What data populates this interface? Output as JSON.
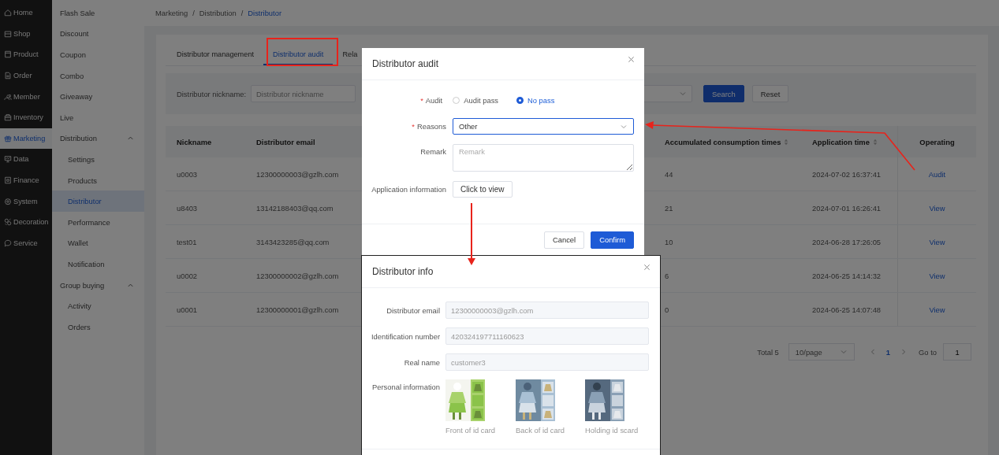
{
  "sidebar": {
    "items": [
      {
        "label": "Home",
        "selected": false
      },
      {
        "label": "Shop",
        "selected": false
      },
      {
        "label": "Product",
        "selected": false
      },
      {
        "label": "Order",
        "selected": false
      },
      {
        "label": "Member",
        "selected": false
      },
      {
        "label": "Inventory",
        "selected": false
      },
      {
        "label": "Marketing",
        "selected": true
      },
      {
        "label": "Data",
        "selected": false
      },
      {
        "label": "Finance",
        "selected": false
      },
      {
        "label": "System",
        "selected": false
      },
      {
        "label": "Decoration",
        "selected": false
      },
      {
        "label": "Service",
        "selected": false
      }
    ]
  },
  "submenu": {
    "items": [
      {
        "label": "Flash Sale",
        "selected": false
      },
      {
        "label": "Discount",
        "selected": false
      },
      {
        "label": "Coupon",
        "selected": false
      },
      {
        "label": "Combo",
        "selected": false
      },
      {
        "label": "Giveaway",
        "selected": false
      },
      {
        "label": "Live",
        "selected": false
      },
      {
        "label": "Distribution",
        "selected": false,
        "expanded": true,
        "children": [
          {
            "label": "Settings",
            "selected": false
          },
          {
            "label": "Products",
            "selected": false
          },
          {
            "label": "Distributor",
            "selected": true
          },
          {
            "label": "Performance",
            "selected": false
          },
          {
            "label": "Wallet",
            "selected": false
          },
          {
            "label": "Notification",
            "selected": false
          }
        ]
      },
      {
        "label": "Group buying",
        "selected": false,
        "expanded": true,
        "children": [
          {
            "label": "Activity",
            "selected": false
          },
          {
            "label": "Orders",
            "selected": false
          }
        ]
      }
    ]
  },
  "breadcrumb": {
    "separator": "/",
    "items": [
      "Marketing",
      "Distribution",
      "Distributor"
    ]
  },
  "tabs": [
    {
      "label": "Distributor management",
      "selected": false
    },
    {
      "label": "Distributor audit",
      "selected": true
    },
    {
      "label": "Rela",
      "selected": false
    }
  ],
  "filter": {
    "label": "Distributor nickname:",
    "placeholder": "Distributor nickname",
    "buttons": [
      "Search",
      "Reset"
    ]
  },
  "table": {
    "columns": [
      {
        "label": "Nickname",
        "sortable": false
      },
      {
        "label": "Distributor email",
        "sortable": false
      },
      {
        "label": "Accumulated consumption times",
        "sortable": true
      },
      {
        "label": "Application time",
        "sortable": true
      },
      {
        "label": "Operating",
        "sortable": false
      }
    ],
    "rows": [
      {
        "cells": [
          "u0003",
          "12300000003@gzlh.com",
          "44",
          "2024-07-02 16:37:41"
        ],
        "action": "Audit"
      },
      {
        "cells": [
          "u8403",
          "13142188403@qq.com",
          "21",
          "2024-07-01 16:26:41"
        ],
        "action": "View"
      },
      {
        "cells": [
          "test01",
          "3143423285@qq.com",
          "10",
          "2024-06-28 17:26:05"
        ],
        "action": "View"
      },
      {
        "cells": [
          "u0002",
          "12300000002@gzlh.com",
          "6",
          "2024-06-25 14:14:32"
        ],
        "action": "View"
      },
      {
        "cells": [
          "u0001",
          "12300000001@gzlh.com",
          "0",
          "2024-06-25 14:07:48"
        ],
        "action": "View"
      }
    ]
  },
  "pagination": {
    "total": "Total 5",
    "page_size": "10/page",
    "pages": [
      {
        "label": "1",
        "selected": true
      }
    ],
    "goto_label": "Go to",
    "goto_value": "1"
  },
  "audit_dialog": {
    "title": "Distributor audit",
    "fields": [
      {
        "kind": "radio",
        "mark": "*",
        "label": "Audit",
        "options": [
          {
            "label": "Audit pass",
            "selected": false
          },
          {
            "label": "No pass",
            "selected": true
          }
        ]
      },
      {
        "kind": "select",
        "mark": "*",
        "label": "Reasons",
        "value": "Other"
      },
      {
        "kind": "textarea",
        "label": "Remark",
        "placeholder": "Remark"
      },
      {
        "kind": "button",
        "label": "Application information",
        "button": "Click to view"
      }
    ],
    "buttons": [
      "Cancel",
      "Confirm"
    ]
  },
  "info_dialog": {
    "title": "Distributor info",
    "fields": [
      {
        "label": "Distributor email",
        "value": "12300000003@gzlh.com",
        "disabled": true
      },
      {
        "label": "Identification number",
        "value": "420324197711160623",
        "disabled": true
      },
      {
        "label": "Real name",
        "value": "customer3",
        "disabled": true
      }
    ],
    "images_label": "Personal information",
    "images": [
      {
        "kind": "picture",
        "caption": "Front of id card"
      },
      {
        "kind": "picture",
        "caption": "Back of id card"
      },
      {
        "kind": "picture",
        "caption": "Holding id scard"
      }
    ]
  }
}
